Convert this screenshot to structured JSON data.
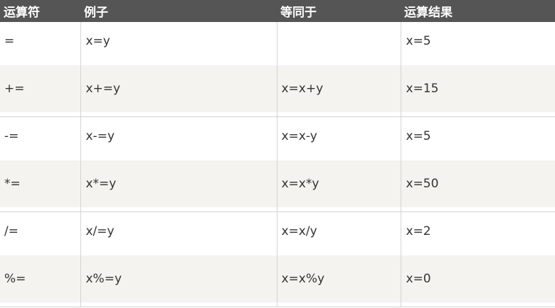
{
  "table": {
    "headers": [
      "运算符",
      "例子",
      "等同于",
      "运算结果"
    ],
    "rows": [
      {
        "operator": "=",
        "example": "x=y",
        "equivalent": "",
        "result": "x=5"
      },
      {
        "operator": "+=",
        "example": "x+=y",
        "equivalent": "x=x+y",
        "result": "x=15"
      },
      {
        "operator": "-=",
        "example": "x-=y",
        "equivalent": "x=x-y",
        "result": "x=5"
      },
      {
        "operator": "*=",
        "example": "x*=y",
        "equivalent": "x=x*y",
        "result": "x=50"
      },
      {
        "operator": "/=",
        "example": "x/=y",
        "equivalent": "x=x/y",
        "result": "x=2"
      },
      {
        "operator": "%=",
        "example": "x%=y",
        "equivalent": "x=x%y",
        "result": "x=0"
      }
    ]
  },
  "colors": {
    "header_bg": "#555555",
    "header_text": "#ffffff",
    "alt_row_bg": "#f4f3ef",
    "text": "#333333",
    "border": "#d4d4d4"
  }
}
